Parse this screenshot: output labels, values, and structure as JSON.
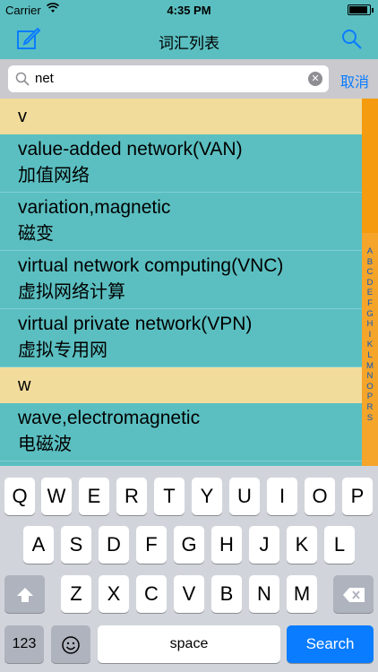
{
  "status_bar": {
    "carrier": "Carrier",
    "wifi_icon": "wifi-icon",
    "time": "4:35 PM",
    "battery_level": 0.9
  },
  "nav": {
    "title": "词汇列表",
    "left_icon": "compose-icon",
    "right_icon": "search-icon"
  },
  "search": {
    "value": "net",
    "cancel_label": "取消"
  },
  "list": {
    "sections": [
      {
        "header": "v",
        "rows": [
          {
            "en": "value-added network(VAN)",
            "cn": "加值网络"
          },
          {
            "en": "variation,magnetic",
            "cn": "磁变"
          },
          {
            "en": "virtual network computing(VNC)",
            "cn": "虚拟网络计算"
          },
          {
            "en": "virtual private network(VPN)",
            "cn": "虚拟专用网"
          }
        ]
      },
      {
        "header": "w",
        "rows": [
          {
            "en": "wave,electromagnetic",
            "cn": "电磁波"
          }
        ]
      }
    ]
  },
  "index_letters": [
    "A",
    "B",
    "C",
    "D",
    "E",
    "F",
    "G",
    "H",
    "I",
    "K",
    "L",
    "M",
    "N",
    "O",
    "P",
    "R",
    "S"
  ],
  "keyboard": {
    "row1": [
      "Q",
      "W",
      "E",
      "R",
      "T",
      "Y",
      "U",
      "I",
      "O",
      "P"
    ],
    "row2": [
      "A",
      "S",
      "D",
      "F",
      "G",
      "H",
      "J",
      "K",
      "L"
    ],
    "row3": [
      "Z",
      "X",
      "C",
      "V",
      "B",
      "N",
      "M"
    ],
    "numbers_label": "123",
    "space_label": "space",
    "search_label": "Search",
    "shift_icon": "shift-icon",
    "delete_icon": "delete-icon",
    "emoji_icon": "emoji-icon"
  },
  "colors": {
    "teal": "#5bbfc1",
    "section": "#f2dc9c",
    "index": "#f4a52a",
    "accent": "#0a7cff"
  }
}
